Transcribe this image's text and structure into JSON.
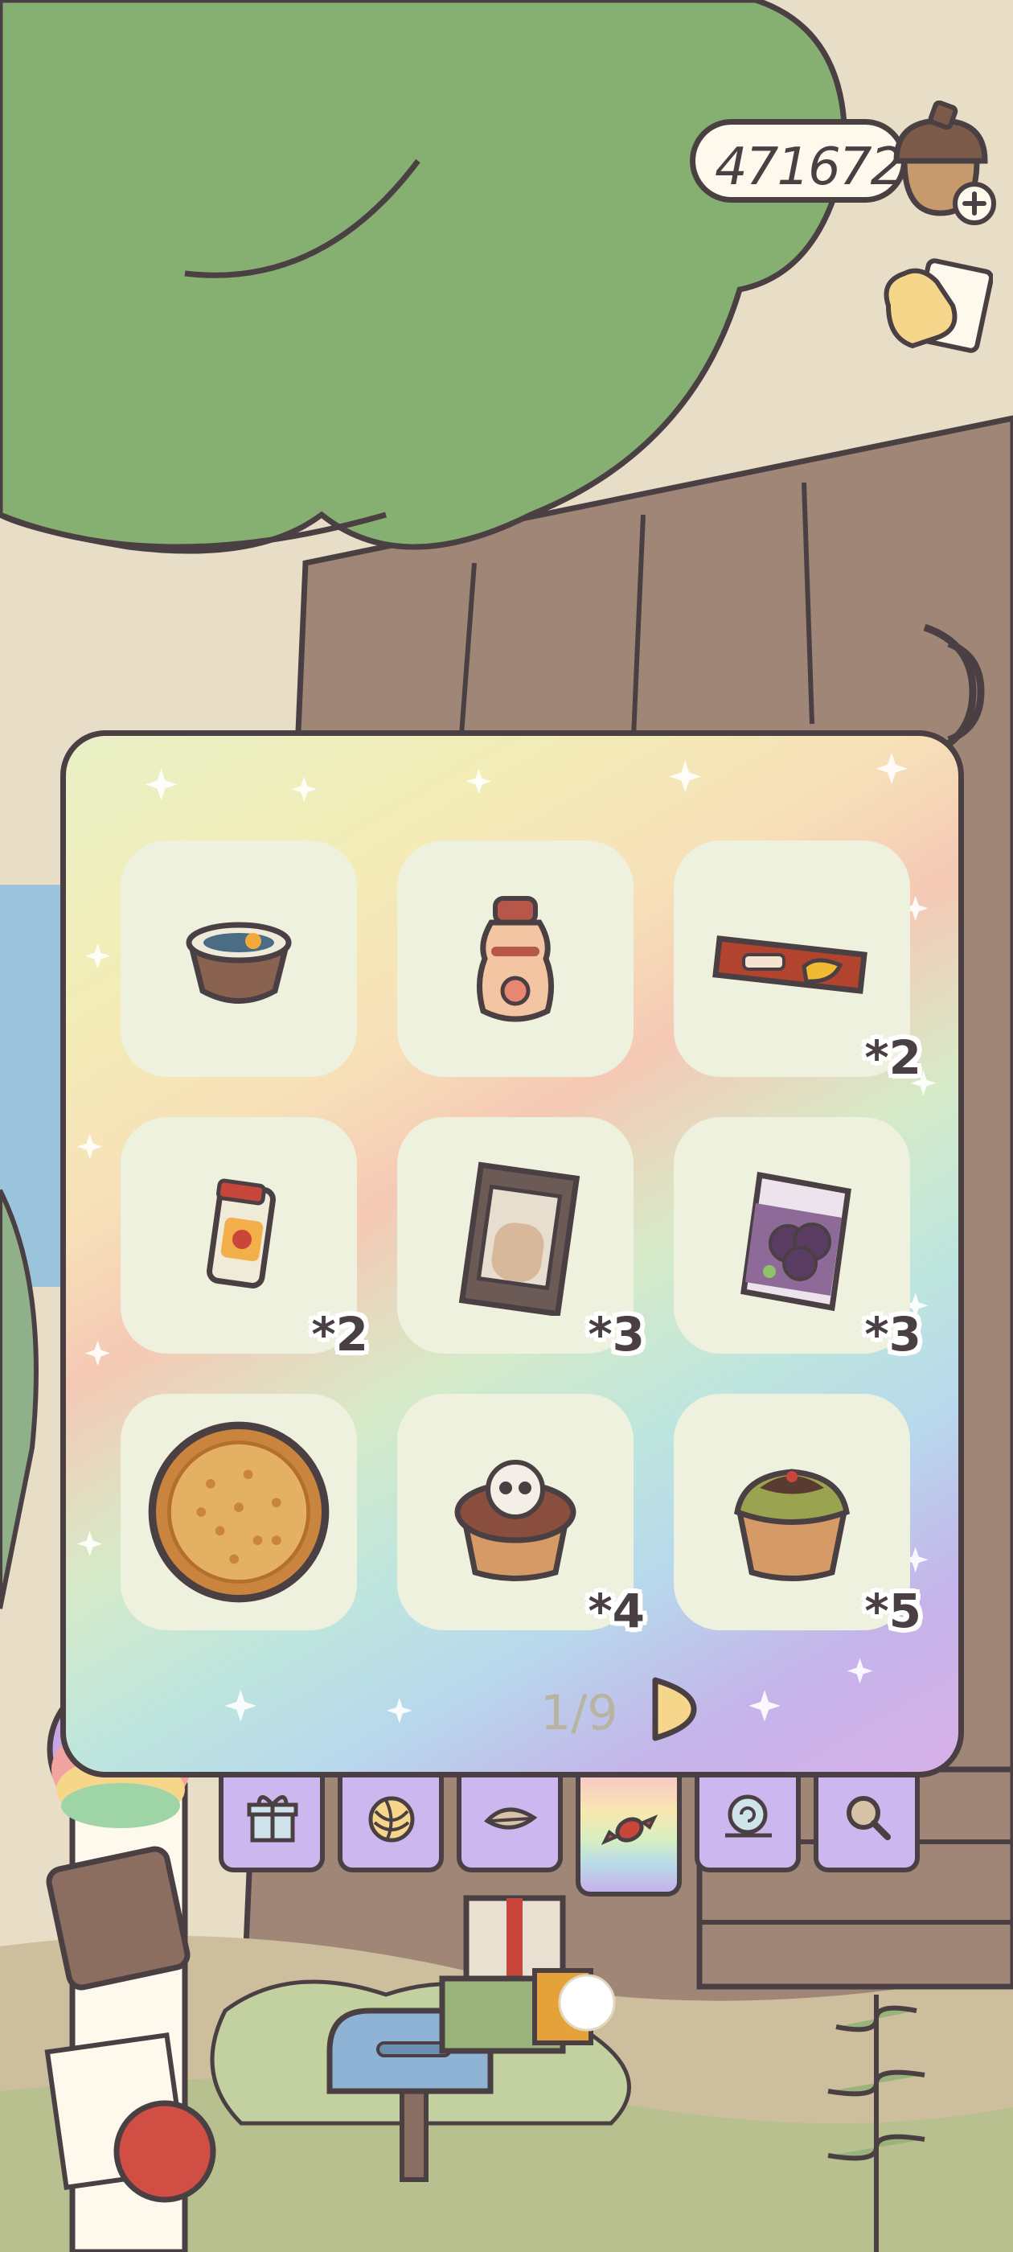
{
  "header": {
    "acorn_count": "471672",
    "icons": {
      "currency": "acorn-icon",
      "add": "plus-icon",
      "cheer": "clover-thumb-icon"
    }
  },
  "panel": {
    "pager": "1/9",
    "items": [
      {
        "name": "pudding-cup-icon",
        "qty": ""
      },
      {
        "name": "milk-bottle-icon",
        "qty": ""
      },
      {
        "name": "chocolate-bar-icon",
        "qty": "*2"
      },
      {
        "name": "jam-jar-icon",
        "qty": "*2"
      },
      {
        "name": "cookie-box-icon",
        "qty": "*3"
      },
      {
        "name": "grape-candy-bag-icon",
        "qty": "*3"
      },
      {
        "name": "round-biscuit-icon",
        "qty": ""
      },
      {
        "name": "skull-tart-icon",
        "qty": "*4"
      },
      {
        "name": "matcha-tart-icon",
        "qty": "*5"
      }
    ]
  },
  "tabs": [
    {
      "name": "tab-gifts",
      "icon": "gift-icon"
    },
    {
      "name": "tab-yarn",
      "icon": "yarn-icon"
    },
    {
      "name": "tab-leaf",
      "icon": "leaf-icon"
    },
    {
      "name": "tab-snacks",
      "icon": "candy-icon",
      "active": true
    },
    {
      "name": "tab-snail",
      "icon": "snail-icon"
    },
    {
      "name": "tab-search",
      "icon": "magnifier-icon"
    }
  ],
  "colors": {
    "outline": "#4a4043",
    "tree_canopy": "#86af72",
    "trunk": "#a08676",
    "slot_bg": "#eef1dd",
    "tab_bg": "#cdb7ef"
  }
}
